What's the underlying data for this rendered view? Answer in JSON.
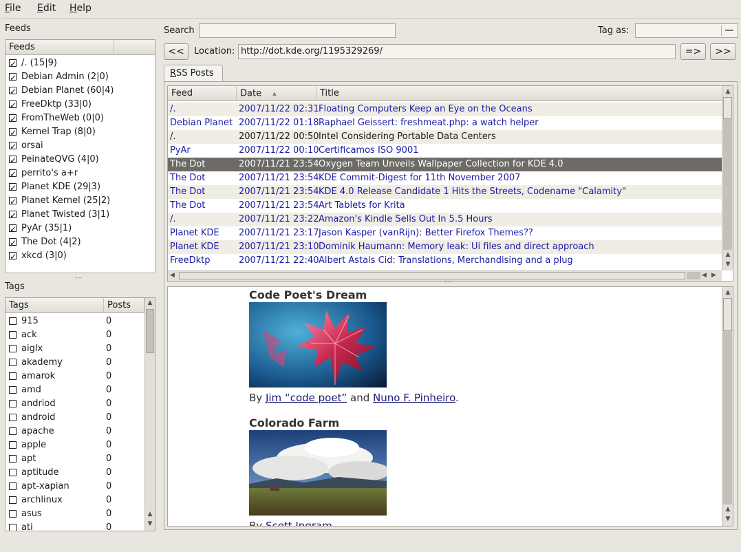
{
  "menubar": {
    "items": [
      {
        "label": "File",
        "key": "menu-file"
      },
      {
        "label": "Edit",
        "key": "menu-edit"
      },
      {
        "label": "Help",
        "key": "menu-help"
      }
    ]
  },
  "feeds_panel": {
    "section_label": "Feeds",
    "column_header": "Feeds",
    "items": [
      {
        "label": "/. (15|9)",
        "checked": true
      },
      {
        "label": "Debian Admin (2|0)",
        "checked": true
      },
      {
        "label": "Debian Planet (60|4)",
        "checked": true
      },
      {
        "label": "FreeDktp (33|0)",
        "checked": true
      },
      {
        "label": "FromTheWeb (0|0)",
        "checked": true
      },
      {
        "label": "Kernel Trap (8|0)",
        "checked": true
      },
      {
        "label": "orsai",
        "checked": true
      },
      {
        "label": "PeinateQVG (4|0)",
        "checked": true
      },
      {
        "label": "perrito's a+r",
        "checked": true
      },
      {
        "label": "Planet KDE (29|3)",
        "checked": true
      },
      {
        "label": "Planet Kernel (25|2)",
        "checked": true
      },
      {
        "label": "Planet Twisted (3|1)",
        "checked": true
      },
      {
        "label": "PyAr (35|1)",
        "checked": true
      },
      {
        "label": "The Dot (4|2)",
        "checked": true
      },
      {
        "label": "xkcd (3|0)",
        "checked": true
      }
    ]
  },
  "tags_panel": {
    "section_label": "Tags",
    "col_tags": "Tags",
    "col_posts": "Posts",
    "items": [
      {
        "name": "915",
        "posts": "0"
      },
      {
        "name": "ack",
        "posts": "0"
      },
      {
        "name": "aiglx",
        "posts": "0"
      },
      {
        "name": "akademy",
        "posts": "0"
      },
      {
        "name": "amarok",
        "posts": "0"
      },
      {
        "name": "amd",
        "posts": "0"
      },
      {
        "name": "andriod",
        "posts": "0"
      },
      {
        "name": "android",
        "posts": "0"
      },
      {
        "name": "apache",
        "posts": "0"
      },
      {
        "name": "apple",
        "posts": "0"
      },
      {
        "name": "apt",
        "posts": "0"
      },
      {
        "name": "aptitude",
        "posts": "0"
      },
      {
        "name": "apt-xapian",
        "posts": "0"
      },
      {
        "name": "archlinux",
        "posts": "0"
      },
      {
        "name": "asus",
        "posts": "0"
      },
      {
        "name": "ati",
        "posts": "0"
      }
    ]
  },
  "search": {
    "label": "Search",
    "value": ""
  },
  "tagas": {
    "label": "Tag as:",
    "value": ""
  },
  "location": {
    "back_label": "<<",
    "label": "Location:",
    "value": "http://dot.kde.org/1195329269/",
    "go_label": "=>",
    "forward_label": ">>"
  },
  "tabs": [
    {
      "label": "RSS Posts"
    }
  ],
  "posts_table": {
    "col_feed": "Feed",
    "col_date": "Date",
    "col_title": "Title",
    "rows": [
      {
        "feed": "/.",
        "date": "2007/11/22 02:31",
        "title": "Floating Computers Keep an Eye on the Oceans",
        "state": "unread"
      },
      {
        "feed": "Debian Planet",
        "date": "2007/11/22 01:18",
        "title": "Raphael Geissert: freshmeat.php: a watch helper",
        "state": "unread"
      },
      {
        "feed": "/.",
        "date": "2007/11/22 00:50",
        "title": "Intel Considering Portable Data Centers",
        "state": "read"
      },
      {
        "feed": "PyAr",
        "date": "2007/11/22 00:10",
        "title": "Certificamos ISO 9001",
        "state": "unread"
      },
      {
        "feed": "The Dot",
        "date": "2007/11/21 23:54",
        "title": "Oxygen Team Unveils Wallpaper Collection for KDE 4.0",
        "state": "selected"
      },
      {
        "feed": "The Dot",
        "date": "2007/11/21 23:54",
        "title": "KDE Commit-Digest for 11th November 2007",
        "state": "unread"
      },
      {
        "feed": "The Dot",
        "date": "2007/11/21 23:54",
        "title": "KDE 4.0 Release Candidate 1 Hits the Streets, Codename \"Calamity\"",
        "state": "unread"
      },
      {
        "feed": "The Dot",
        "date": "2007/11/21 23:54",
        "title": "Art Tablets for Krita",
        "state": "unread"
      },
      {
        "feed": "/.",
        "date": "2007/11/21 23:22",
        "title": "Amazon's Kindle Sells Out In 5.5 Hours",
        "state": "unread"
      },
      {
        "feed": "Planet KDE",
        "date": "2007/11/21 23:17",
        "title": "Jason Kasper (vanRijn): Better Firefox Themes??",
        "state": "unread"
      },
      {
        "feed": "Planet KDE",
        "date": "2007/11/21 23:10",
        "title": "Dominik Haumann: Memory leak: Ui files and direct approach",
        "state": "unread"
      },
      {
        "feed": "FreeDktp",
        "date": "2007/11/21 22:40",
        "title": "Albert Astals Cid: Translations, Merchandising and a plug",
        "state": "unread"
      }
    ]
  },
  "content": {
    "wp1": {
      "title": "Code Poet's Dream",
      "by": "By",
      "author1": "Jim “code poet”",
      "and": "and",
      "author2": "Nuno F. Pinheiro",
      "end": "."
    },
    "wp2": {
      "title": "Colorado Farm",
      "by": "By",
      "author1": "Scott Ingram"
    }
  },
  "colors": {
    "selected_row": "#6e6b67",
    "link": "#1a1aa6",
    "window_bg": "#e9e6e0"
  }
}
